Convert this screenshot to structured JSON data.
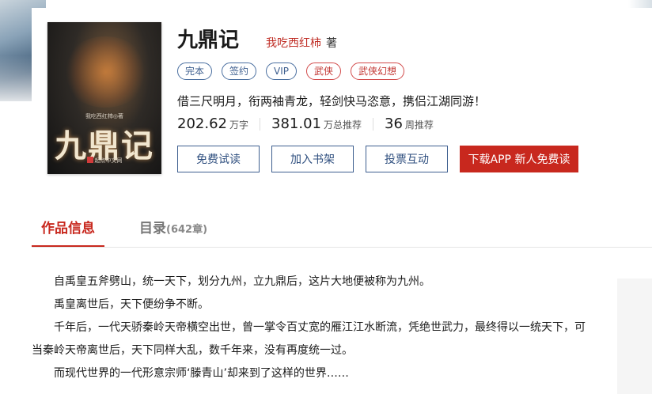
{
  "book": {
    "title": "九鼎记",
    "author": "我吃西红柿",
    "author_suffix": "著",
    "tags": [
      "完本",
      "签约",
      "VIP",
      "武侠",
      "武侠幻想"
    ],
    "intro": "借三尺明月，衔两袖青龙，轻剑快马恣意，携侣江湖同游！",
    "stats": {
      "words": "202.62",
      "words_unit": "万字",
      "recommend_total": "381.01",
      "recommend_total_unit": "万总推荐",
      "recommend_week": "36",
      "recommend_week_unit": "周推荐"
    },
    "cover": {
      "title": "九鼎记",
      "author_line": "我吃西红柿◎著",
      "publisher": "起点中文网"
    }
  },
  "actions": {
    "free_read": "免费试读",
    "add_shelf": "加入书架",
    "vote": "投票互动",
    "download_app": "下载APP  新人免费读"
  },
  "tabs": {
    "info": "作品信息",
    "catalog": "目录",
    "catalog_count": "(642章)"
  },
  "summary": [
    "自禹皇五斧劈山，统一天下，划分九州，立九鼎后，这片大地便被称为九州。",
    "禹皇离世后，天下便纷争不断。",
    "千年后，一代天骄秦岭天帝横空出世，曾一掌令百丈宽的雁江江水断流，凭绝世武力，最终得以一统天下，可当秦岭天帝离世后，天下同样大乱，数千年来，没有再度统一过。",
    "而现代世界的一代形意宗师‘滕青山’却来到了这样的世界……"
  ],
  "colors": {
    "accent": "#c8281e",
    "tag_blue": "#3e5f8f"
  }
}
